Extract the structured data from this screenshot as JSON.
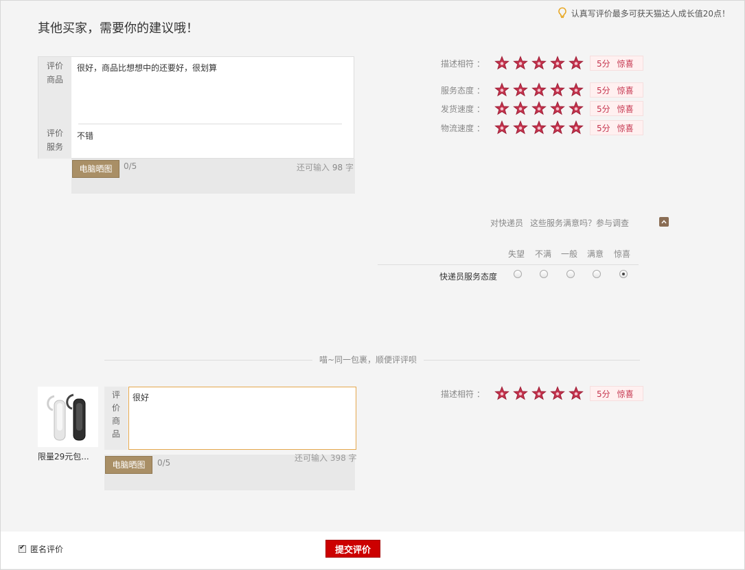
{
  "header": {
    "title": "其他买家，需要你的建议哦！",
    "tip": "认真写评价最多可获天猫达人成长值20点！"
  },
  "item1": {
    "goods_label": "评价商品",
    "goods_text": "很好，商品比想想中的还要好，很划算",
    "service_label": "评价服务",
    "service_text": "不错",
    "upload_label": "电脑晒图",
    "upload_count": "0/5",
    "remaining_prefix": "还可输入",
    "remaining_count": "98",
    "remaining_suffix": "字"
  },
  "ratings": [
    {
      "label": "描述相符",
      "colon": "：",
      "stars": 5,
      "score": "5分",
      "desc": "惊喜"
    },
    {
      "label": "服务态度",
      "colon": "：",
      "stars": 5,
      "score": "5分",
      "desc": "惊喜"
    },
    {
      "label": "发货速度",
      "colon": "：",
      "stars": 5,
      "score": "5分",
      "desc": "惊喜"
    },
    {
      "label": "物流速度",
      "colon": "：",
      "stars": 5,
      "score": "5分",
      "desc": "惊喜"
    }
  ],
  "courier": {
    "question_a": "对快递员",
    "question_b": "这些服务满意吗？参与调查",
    "options": [
      "失望",
      "不满",
      "一般",
      "满意",
      "惊喜"
    ],
    "row_label": "快递员服务态度",
    "selected_index": 4
  },
  "separator": "喵~同一包裹，顺便评评呗",
  "item2": {
    "thumb_caption": "限量29元包...",
    "goods_label": "评价商品",
    "goods_text": "很好",
    "upload_label": "电脑晒图",
    "upload_count": "0/5",
    "remaining": "还可输入 398 字",
    "rating": {
      "label": "描述相符",
      "colon": "：",
      "stars": 5,
      "score": "5分",
      "desc": "惊喜"
    }
  },
  "footer": {
    "anonymous_label": "匿名评价",
    "anonymous_checked": true,
    "submit_label": "提交评价"
  },
  "colors": {
    "star": "#c4334d",
    "accent_brown": "#a98f66",
    "submit_red": "#cc0000"
  }
}
